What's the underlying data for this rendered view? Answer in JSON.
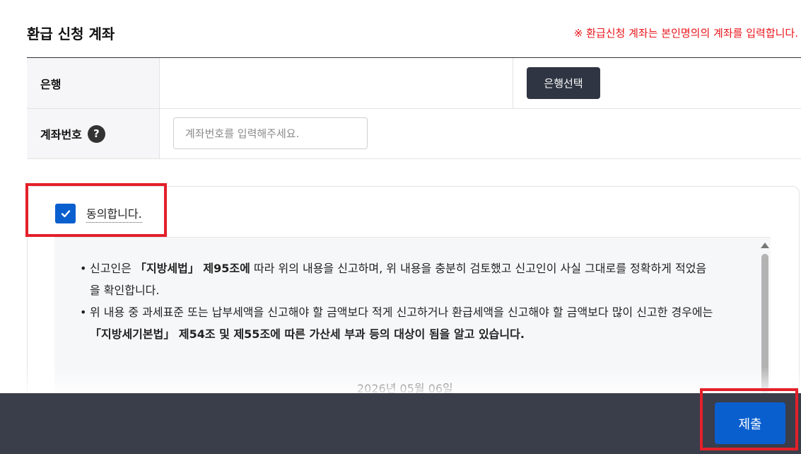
{
  "refund_account": {
    "title": "환급 신청 계좌",
    "notice": "※ 환급신청 계좌는 본인명의의 계좌를 입력합니다."
  },
  "bank": {
    "label": "은행",
    "select_button": "은행선택"
  },
  "account": {
    "label": "계좌번호",
    "help_icon": "?",
    "placeholder": "계좌번호를 입력해주세요."
  },
  "agreement": {
    "checked": true,
    "label": "동의합니다.",
    "terms": [
      {
        "pre": "신고인은 ",
        "bold": "「지방세법」 제95조에",
        "post": " 따라 위의 내용을 신고하며, 위 내용을 충분히 검토했고 신고인이 사실 그대로를 정확하게 적었음을 확인합니다."
      },
      {
        "pre": "위 내용 중 과세표준 또는 납부세액을 신고해야 할 금액보다 적게 신고하거나 환급세액을 신고해야 할 금액보다 많이 신고한 경우에는 ",
        "bold": "「지방세기본법」 제54조 및 제55조에 따른 가산세 부과 등의 대상이 됨을 알고 있습니다.",
        "post": ""
      }
    ],
    "date": "2026년 05월 06일"
  },
  "footer": {
    "submit_label": "제출"
  },
  "colors": {
    "primary": "#0a5fcf",
    "notice_red": "#e8141b",
    "dark_button": "#2f3542",
    "footer_bar": "#3a3d4a",
    "highlight_red": "#e3202a"
  }
}
